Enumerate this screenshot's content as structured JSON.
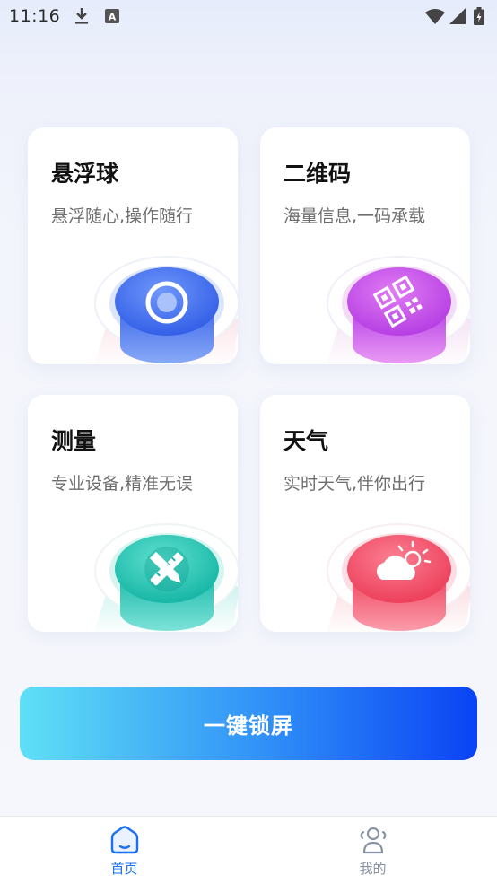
{
  "status_bar": {
    "time": "11:16",
    "icons": [
      "download-icon",
      "a-notification-icon",
      "wifi-icon",
      "signal-icon",
      "battery-icon"
    ]
  },
  "cards": [
    {
      "title": "悬浮球",
      "subtitle": "悬浮随心,操作随行",
      "icon": "target-icon",
      "color": "#3f6ef0"
    },
    {
      "title": "二维码",
      "subtitle": "海量信息,一码承载",
      "icon": "qr-code-icon",
      "color": "#b43fe8"
    },
    {
      "title": "测量",
      "subtitle": "专业设备,精准无误",
      "icon": "ruler-pencil-icon",
      "color": "#1bbfae"
    },
    {
      "title": "天气",
      "subtitle": "实时天气,伴你出行",
      "icon": "cloud-sun-icon",
      "color": "#f0455e"
    }
  ],
  "lock_button": {
    "label": "一键锁屏"
  },
  "bottom_nav": {
    "items": [
      {
        "label": "首页",
        "icon": "home-icon",
        "active": true
      },
      {
        "label": "我的",
        "icon": "profile-icon",
        "active": false
      }
    ],
    "active_color": "#1b6ff5",
    "inactive_color": "#8a93a6"
  }
}
